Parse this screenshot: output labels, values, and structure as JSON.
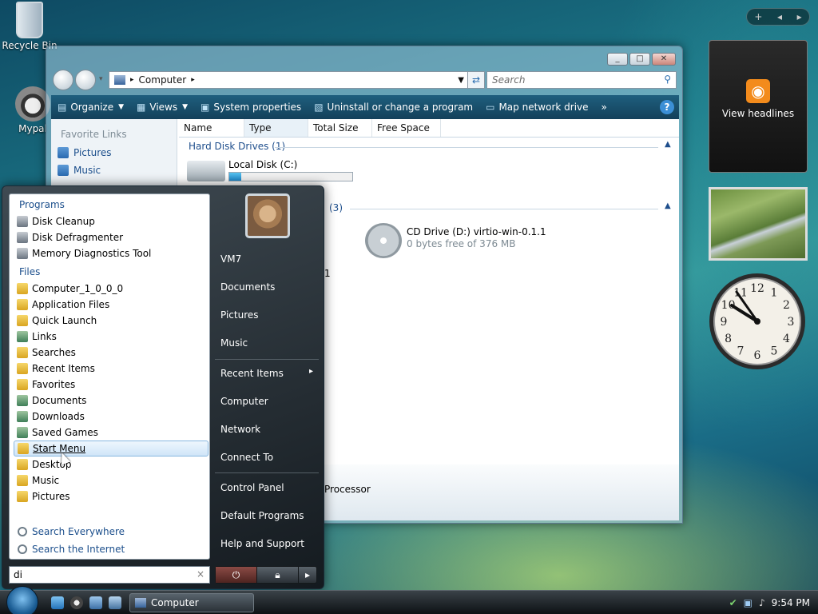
{
  "desktop": {
    "icons": [
      {
        "label": "Recycle Bin",
        "icon": "recycle-bin-icon"
      },
      {
        "label": "Mypal",
        "icon": "mypal-icon"
      }
    ]
  },
  "gadgets": {
    "feed_label": "View headlines",
    "clock_numbers": [
      "12",
      "1",
      "2",
      "3",
      "4",
      "5",
      "6",
      "7",
      "8",
      "9",
      "10",
      "11"
    ]
  },
  "explorer": {
    "address": "Computer",
    "search_placeholder": "Search",
    "toolbar": [
      {
        "label": "Organize",
        "dropdown": true
      },
      {
        "label": "Views",
        "dropdown": true
      },
      {
        "label": "System properties",
        "dropdown": false
      },
      {
        "label": "Uninstall or change a program",
        "dropdown": false
      },
      {
        "label": "Map network drive",
        "dropdown": false
      }
    ],
    "toolbar_more": "»",
    "help_label": "?",
    "favorite_links_title": "Favorite Links",
    "favorite_links": [
      "Pictures",
      "Music"
    ],
    "columns": [
      "Name",
      "Type",
      "Total Size",
      "Free Space"
    ],
    "hdd_group": "Hard Disk Drives (1)",
    "local_disk": {
      "name": "Local Disk (C:)",
      "used_fraction": 0.1
    },
    "removable_group_count": "(3)",
    "cd_drive": {
      "name": "CD Drive (D:) virtio-win-0.1.1",
      "detail": "0 bytes free of 376 MB"
    },
    "partial_label": "1",
    "details_text": "Processor"
  },
  "start_menu": {
    "programs_title": "Programs",
    "programs": [
      {
        "label": "Disk Cleanup",
        "icon": "disk-cleanup-icon"
      },
      {
        "label": "Disk Defragmenter",
        "icon": "disk-defragmenter-icon"
      },
      {
        "label": "Memory Diagnostics Tool",
        "icon": "memory-diagnostics-icon"
      }
    ],
    "files_title": "Files",
    "files": [
      {
        "label": "Computer_1_0_0_0",
        "icon": "folder-icon"
      },
      {
        "label": "Application Files",
        "icon": "folder-icon"
      },
      {
        "label": "Quick Launch",
        "icon": "folder-icon"
      },
      {
        "label": "Links",
        "icon": "folder-icon"
      },
      {
        "label": "Searches",
        "icon": "folder-icon"
      },
      {
        "label": "Recent Items",
        "icon": "folder-icon"
      },
      {
        "label": "Favorites",
        "icon": "folder-icon"
      },
      {
        "label": "Documents",
        "icon": "folder-icon"
      },
      {
        "label": "Downloads",
        "icon": "folder-icon"
      },
      {
        "label": "Saved Games",
        "icon": "folder-icon"
      },
      {
        "label": "Start Menu",
        "icon": "folder-icon",
        "highlighted": true
      },
      {
        "label": "Desktop",
        "icon": "folder-icon"
      },
      {
        "label": "Music",
        "icon": "folder-icon"
      },
      {
        "label": "Pictures",
        "icon": "folder-icon"
      }
    ],
    "search_everywhere": "Search Everywhere",
    "search_internet": "Search the Internet",
    "search_value": "di",
    "search_clear": "×",
    "right_items_1": [
      "VM7",
      "Documents",
      "Pictures",
      "Music"
    ],
    "right_items_2": [
      "Recent Items",
      "Computer",
      "Network",
      "Connect To"
    ],
    "right_items_3": [
      "Control Panel",
      "Default Programs",
      "Help and Support"
    ],
    "recent_arrow": "▸",
    "power_icons": [
      "power-icon",
      "lock-icon",
      "arrow-icon"
    ]
  },
  "taskbar": {
    "task_label": "Computer",
    "clock": "9:54 PM"
  },
  "colors": {
    "link_blue": "#1c4f8c",
    "toolbar": "#1f5f7e"
  }
}
